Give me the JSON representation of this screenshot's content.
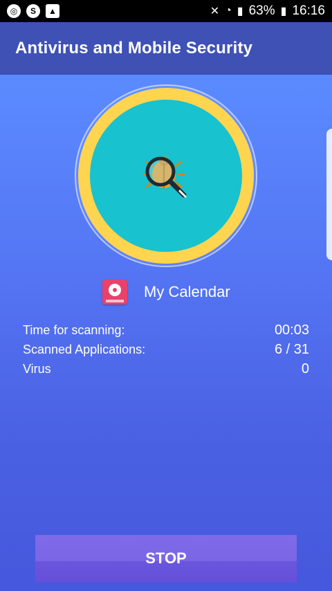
{
  "status_bar": {
    "icons_left": [
      "chrome-icon",
      "skype-icon",
      "gallery-icon"
    ],
    "battery_percent": "63%",
    "time": "16:16"
  },
  "app_bar": {
    "title": "Antivirus and Mobile Security"
  },
  "current_app": {
    "name": "My Calendar",
    "icon": "calendar-flower-icon"
  },
  "stats": [
    {
      "label": "Time for scanning:",
      "value": "00:03"
    },
    {
      "label": "Scanned Applications:",
      "value": "6 / 31"
    },
    {
      "label": "Virus",
      "value": "0"
    }
  ],
  "actions": {
    "stop_label": "STOP"
  },
  "colors": {
    "app_bar": "#3f51b5",
    "ring": "#ffd54f",
    "disc": "#18c2cf",
    "stop_button": "#7b66e6"
  }
}
